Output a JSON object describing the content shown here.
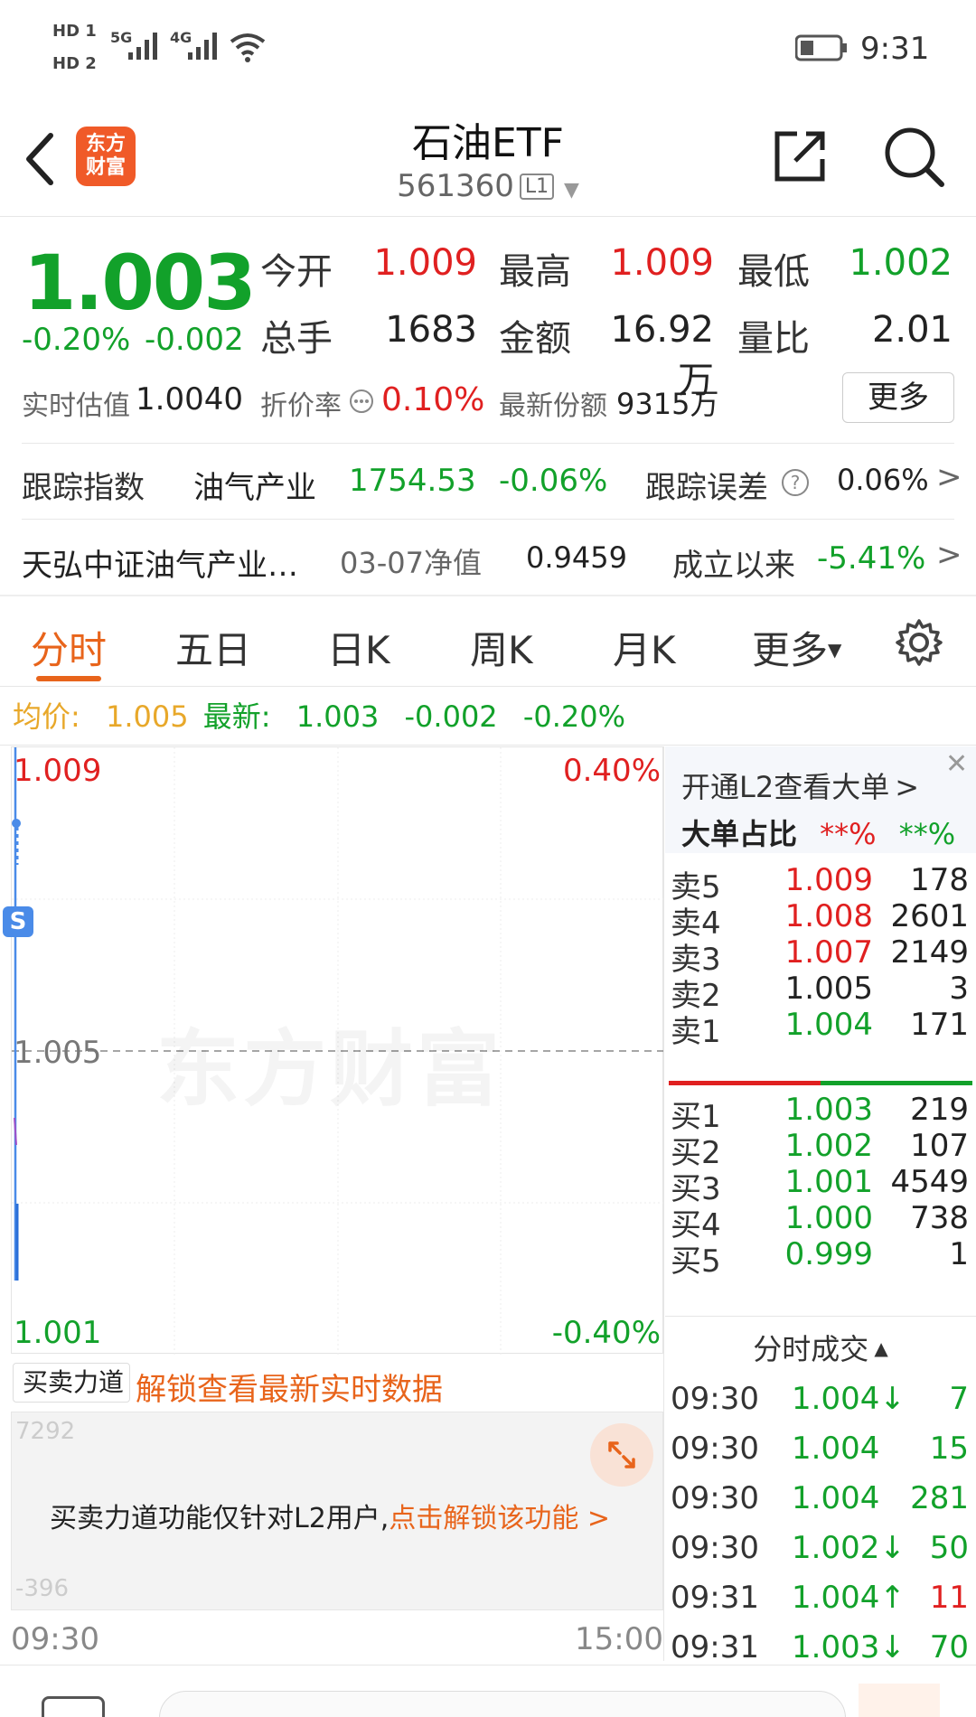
{
  "status": {
    "hd1": "HD 1",
    "hd2": "HD 2",
    "net1": "5G",
    "net2": "4G",
    "time": "9:31"
  },
  "header": {
    "title": "石油ETF",
    "code": "561360",
    "level": "L1",
    "logo_line1": "东方",
    "logo_line2": "财富"
  },
  "quote": {
    "price": "1.003",
    "change_pct": "-0.20%",
    "change": "-0.002",
    "open_label": "今开",
    "open": "1.009",
    "high_label": "最高",
    "high": "1.009",
    "low_label": "最低",
    "low": "1.002",
    "volume_label": "总手",
    "volume": "1683",
    "amount_label": "金额",
    "amount": "16.92万",
    "ratio_label": "量比",
    "ratio": "2.01",
    "iopv_label": "实时估值",
    "iopv": "1.0040",
    "discount_label": "折价率",
    "discount": "0.10%",
    "shares_label": "最新份额",
    "shares": "9315万",
    "more_label": "更多"
  },
  "tracking": {
    "label": "跟踪指数",
    "index_name": "油气产业",
    "index_value": "1754.53",
    "index_change": "-0.06%",
    "error_label": "跟踪误差",
    "error_value": "0.06%"
  },
  "fund": {
    "name": "天弘中证油气产业…",
    "nav_label": "03-07净值",
    "nav": "0.9459",
    "since_label": "成立以来",
    "since": "-5.41%"
  },
  "tabs": [
    "分时",
    "五日",
    "日K",
    "周K",
    "月K",
    "更多"
  ],
  "avg": {
    "avg_label": "均价:",
    "avg_value": "1.005",
    "latest_label": "最新:",
    "latest_value": "1.003",
    "latest_change": "-0.002",
    "latest_pct": "-0.20%"
  },
  "chart": {
    "y_top": "1.009",
    "y_mid": "1.005",
    "y_bottom": "1.001",
    "pct_top": "0.40%",
    "pct_bottom": "-0.40%",
    "x_start": "09:30",
    "x_end": "15:00",
    "watermark": "东方财富",
    "sub_selector": "买卖力道",
    "unlock_text": "解锁查看最新实时数据",
    "sub_top_label": "7292",
    "sub_bottom_label": "-396",
    "l2_notice": "买卖力道功能仅针对L2用户,",
    "l2_link": "点击解锁该功能 >"
  },
  "l2_promo": {
    "text": "开通L2查看大单",
    "big_order_label": "大单占比",
    "big_buy": "**%",
    "big_sell": "**%"
  },
  "order_book": {
    "asks": [
      {
        "label": "卖5",
        "price": "1.009",
        "vol": "178",
        "color": "red"
      },
      {
        "label": "卖4",
        "price": "1.008",
        "vol": "2601",
        "color": "red"
      },
      {
        "label": "卖3",
        "price": "1.007",
        "vol": "2149",
        "color": "red"
      },
      {
        "label": "卖2",
        "price": "1.005",
        "vol": "3",
        "color": "black"
      },
      {
        "label": "卖1",
        "price": "1.004",
        "vol": "171",
        "color": "green"
      }
    ],
    "bids": [
      {
        "label": "买1",
        "price": "1.003",
        "vol": "219",
        "color": "green"
      },
      {
        "label": "买2",
        "price": "1.002",
        "vol": "107",
        "color": "green"
      },
      {
        "label": "买3",
        "price": "1.001",
        "vol": "4549",
        "color": "green"
      },
      {
        "label": "买4",
        "price": "1.000",
        "vol": "738",
        "color": "green"
      },
      {
        "label": "买5",
        "price": "0.999",
        "vol": "1",
        "color": "green"
      }
    ]
  },
  "trades": {
    "title": "分时成交",
    "rows": [
      {
        "time": "09:30",
        "price": "1.004↓",
        "vol": "7",
        "color": "green"
      },
      {
        "time": "09:30",
        "price": "1.004",
        "vol": "15",
        "color": "green"
      },
      {
        "time": "09:30",
        "price": "1.004",
        "vol": "281",
        "color": "green"
      },
      {
        "time": "09:30",
        "price": "1.002↓",
        "vol": "50",
        "color": "green"
      },
      {
        "time": "09:31",
        "price": "1.004↑",
        "vol": "11",
        "color": "red"
      },
      {
        "time": "09:31",
        "price": "1.003↓",
        "vol": "70",
        "color": "green"
      }
    ]
  }
}
